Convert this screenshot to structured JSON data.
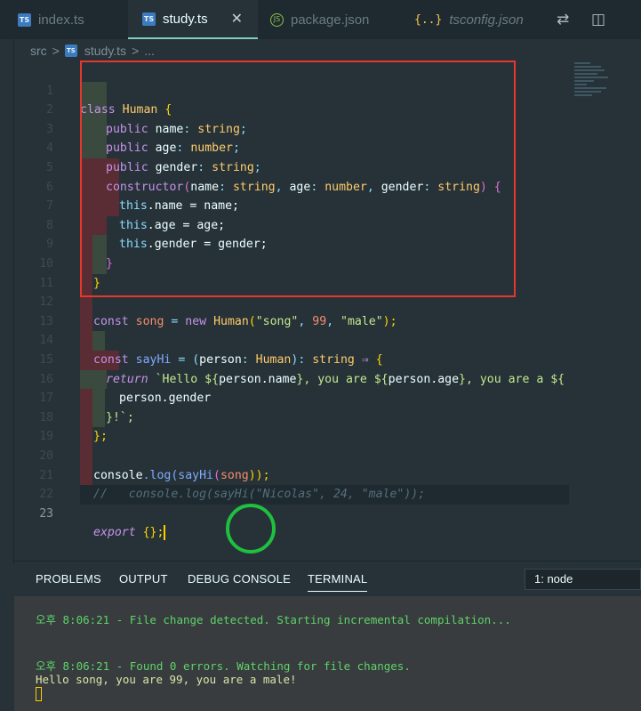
{
  "tabs": [
    {
      "label": "index.ts",
      "icon": "TS"
    },
    {
      "label": "study.ts",
      "icon": "TS",
      "close": "✕"
    },
    {
      "label": "package.json",
      "icon": "JS"
    },
    {
      "label": "tsconfig.json",
      "icon": "{..}"
    }
  ],
  "breadcrumb": {
    "folder": "src",
    "sep": ">",
    "file": "study.ts",
    "more": "..."
  },
  "line_numbers": [
    "1",
    "2",
    "3",
    "4",
    "5",
    "6",
    "7",
    "8",
    "9",
    "10",
    "11",
    "12",
    "13",
    "14",
    "15",
    "16",
    "17",
    "18",
    "19",
    "20",
    "21",
    "22",
    "23"
  ],
  "code": {
    "l1": [
      "class",
      "Human",
      "{"
    ],
    "l2": [
      "public",
      "name",
      ":",
      "string",
      ";"
    ],
    "l3": [
      "public",
      "age",
      ":",
      "number",
      ";"
    ],
    "l4": [
      "public",
      "gender",
      ":",
      "string",
      ";"
    ],
    "l5": [
      "constructor",
      "(",
      "name",
      ": ",
      "string",
      ", ",
      "age",
      ": ",
      "number",
      ", ",
      "gender",
      ": ",
      "string",
      ") ",
      "{"
    ],
    "l6": [
      "this",
      ".name = name;"
    ],
    "l7": [
      "this",
      ".age = age;"
    ],
    "l8": [
      "this",
      ".gender = gender;"
    ],
    "l9": "}",
    "l10": "}",
    "l12": [
      "const",
      "song",
      "=",
      "new",
      "Human",
      "(",
      "\"song\"",
      ", ",
      "99",
      ", ",
      "\"male\"",
      ");"
    ],
    "l14": [
      "const",
      "sayHi",
      "= (",
      "person",
      ": ",
      "Human",
      "): ",
      "string",
      "⇒",
      "{"
    ],
    "l15": [
      "return",
      "`Hello ${",
      "person.name",
      "}, you are ${",
      "person.age",
      "}, you are a ${"
    ],
    "l16": "person.gender",
    "l17": "}!`;",
    "l18": "};",
    "l20": [
      "console",
      ".log(",
      "sayHi",
      "(",
      "song",
      "));"
    ],
    "l21": "//   console.log(sayHi(\"Nicolas\", 24, \"male\"));",
    "l23": [
      "export",
      "{};"
    ]
  },
  "panel": {
    "tabs": [
      "PROBLEMS",
      "OUTPUT",
      "DEBUG CONSOLE",
      "TERMINAL"
    ],
    "terminal_select": "1: node"
  },
  "terminal": {
    "line1": "오후 8:06:21 - File change detected. Starting incremental compilation...",
    "line2": "오후 8:06:21 - Found 0 errors. Watching for file changes.",
    "line3": "Hello song, you are 99, you are a male!"
  }
}
